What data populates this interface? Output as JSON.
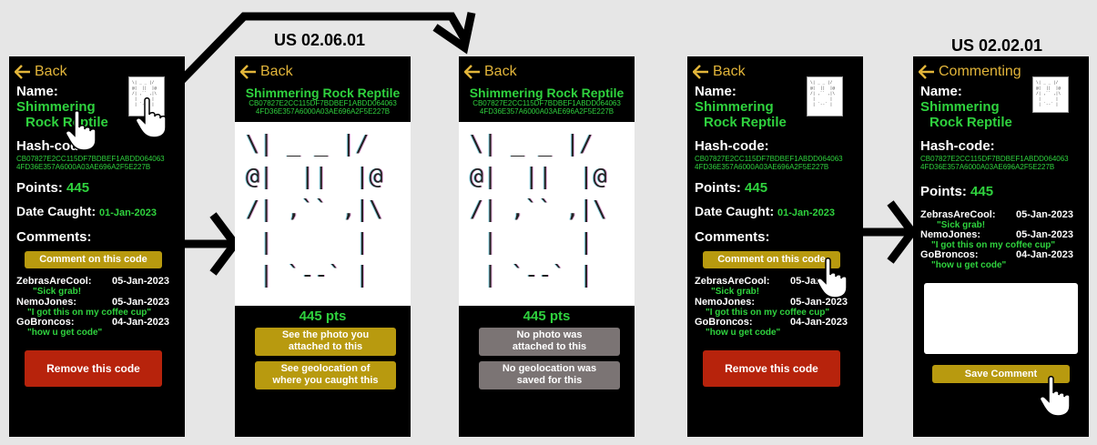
{
  "labels": {
    "us_mid": "US 02.06.01",
    "us_right": "US 02.02.01"
  },
  "common": {
    "back": "Back",
    "name_label": "Name:",
    "name_line1": "Shimmering",
    "name_line2": "Rock Reptile",
    "full_name": "Shimmering Rock Reptile",
    "hash_label": "Hash-code:",
    "hash1": "CB07827E2CC115DF7BDBEF1ABDD064063",
    "hash2": "4FD36E357A6000A03AE696A2F5E227B",
    "points_label": "Points:",
    "points_value": "445",
    "date_label": "Date Caught:",
    "date_value": "01-Jan-2023",
    "comments_label": "Comments:",
    "comment_button": "Comment on this code",
    "remove_button": "Remove this code",
    "pts_text": "445 pts",
    "ascii": [
      "\\|  _  _ |/",
      "@|   ||  |@",
      "/| ,`` ,|\\",
      " |       |",
      " | `-_-` |"
    ]
  },
  "comments": [
    {
      "user": "ZebrasAreCool:",
      "date": "05-Jan-2023",
      "text": "\"Sick grab!"
    },
    {
      "user": "NemoJones:",
      "date": "05-Jan-2023",
      "text": "\"I got this on my coffee cup\""
    },
    {
      "user": "GoBroncos:",
      "date": "04-Jan-2023",
      "text": "\"how u get code\""
    }
  ],
  "screen2": {
    "photo_btn1": "See the photo you",
    "photo_btn2": "attached to this",
    "geo_btn1": "See geolocation of",
    "geo_btn2": "where you caught this"
  },
  "screen3": {
    "photo_btn1": "No photo was",
    "photo_btn2": "attached to this",
    "geo_btn1": "No geolocation was",
    "geo_btn2": "saved for this"
  },
  "screen5": {
    "back": "Commenting",
    "save_button": "Save Comment",
    "comment_input": ""
  }
}
